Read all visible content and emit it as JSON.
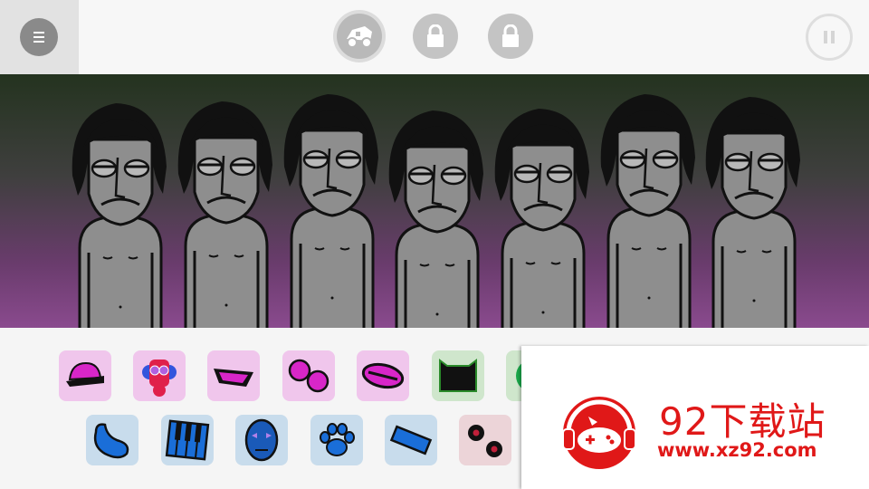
{
  "topbar": {
    "menu_icon": "menu-icon",
    "buttons": [
      {
        "name": "bonus-vehicle-button",
        "icon": "vehicle-icon",
        "state": "selected"
      },
      {
        "name": "bonus-locked-button-1",
        "icon": "lock-icon",
        "state": "locked"
      },
      {
        "name": "bonus-locked-button-2",
        "icon": "lock-icon",
        "state": "locked"
      }
    ],
    "pause_icon": "pause-icon"
  },
  "stage": {
    "characters_count": 7,
    "background_colors": [
      "#24331f",
      "#8a4a8e"
    ]
  },
  "tray": {
    "row1_icons": [
      "cap-icon",
      "robot-head-icon",
      "visor-icon",
      "double-circle-icon",
      "eye-shape-icon",
      "cat-box-icon",
      "green-disc-icon",
      "green-disc-icon",
      "green-shape-icon",
      "green-shape-icon"
    ],
    "row2_icons": [
      "blob-icon",
      "piano-icon",
      "mask-icon",
      "paw-icon",
      "blue-bar-icon",
      "dots-icon"
    ]
  },
  "watermark": {
    "title": "92下载站",
    "url": "www.xz92.com",
    "color": "#e01818"
  }
}
